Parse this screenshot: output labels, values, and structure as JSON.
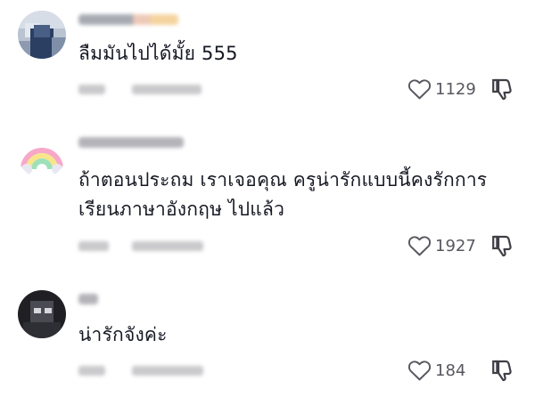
{
  "comments": [
    {
      "text": "ลืมมันไปได้มั้ย 555",
      "likes": "1129",
      "avatar_icon": "profile-photo-icon",
      "username_blurred": true
    },
    {
      "text": "ถ้าตอนประถม เราเจอคุณ ครูน่ารักแบบนี้คงรักการเรียนภาษาอังกฤษ ไปแล้ว",
      "likes": "1927",
      "avatar_icon": "rainbow-icon",
      "username_blurred": true
    },
    {
      "text": "น่ารักจังค่ะ",
      "likes": "184",
      "avatar_icon": "profile-photo-icon",
      "username_blurred": true
    }
  ],
  "icons": {
    "like": "heart-icon",
    "dislike": "thumbs-down-icon"
  },
  "colors": {
    "text": "#161823",
    "meta": "#57575f",
    "blur": "#c9c9cc"
  }
}
